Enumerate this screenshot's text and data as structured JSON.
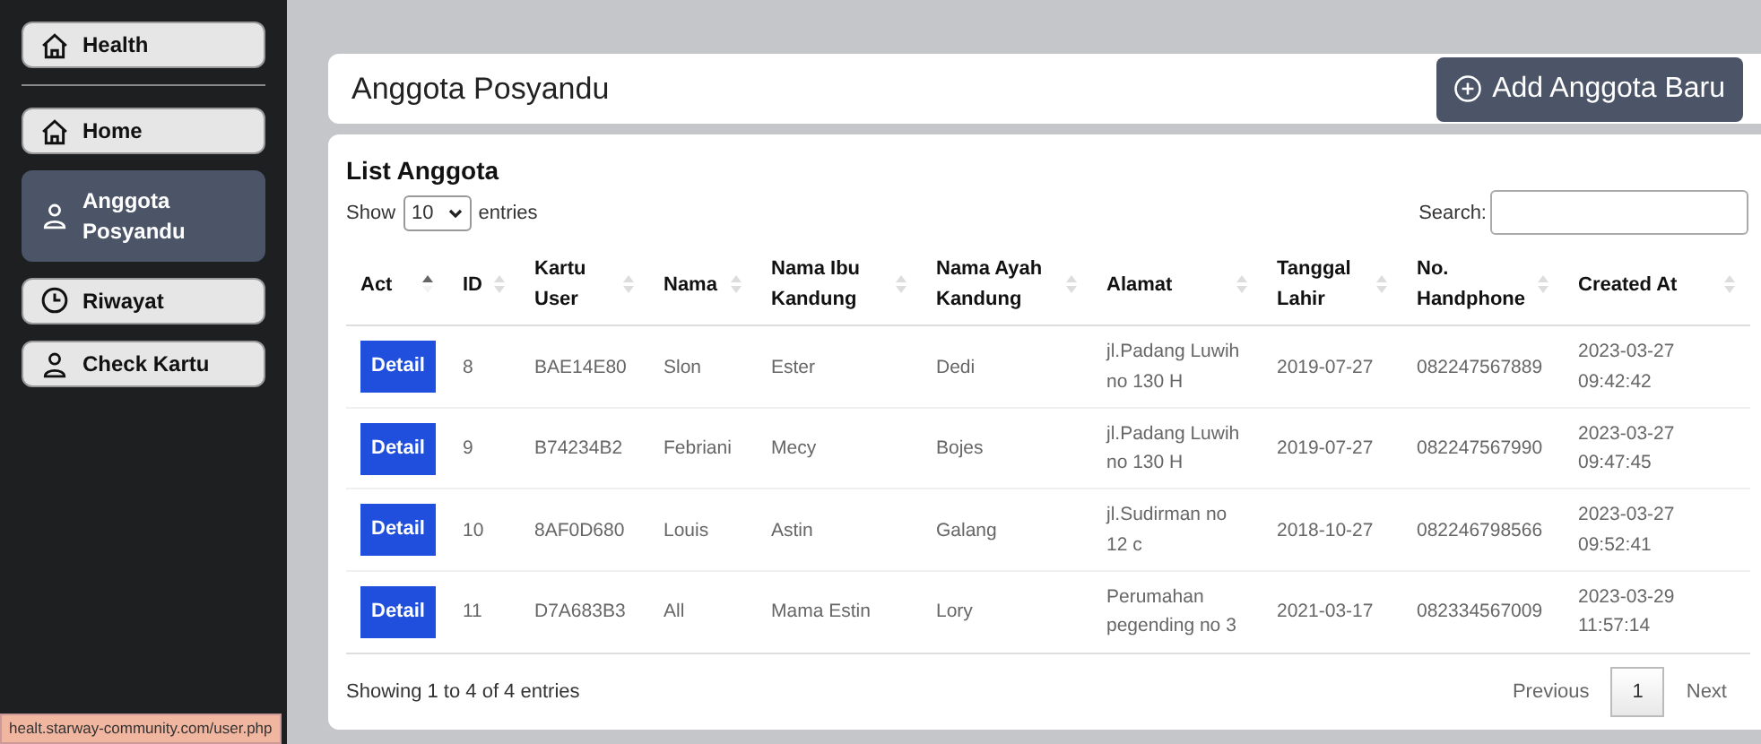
{
  "sidebar": {
    "brand": {
      "label": "Health"
    },
    "items": [
      {
        "label": "Home",
        "selected": false
      },
      {
        "label": "Anggota Posyandu",
        "selected": true
      },
      {
        "label": "Riwayat",
        "selected": false
      },
      {
        "label": "Check Kartu",
        "selected": false
      }
    ]
  },
  "header": {
    "title": "Anggota Posyandu",
    "button": {
      "label": "Add Anggota Baru"
    }
  },
  "list": {
    "title": "List Anggota",
    "length": {
      "before": "Show",
      "value": "10",
      "after": "entries"
    },
    "search_label": "Search:",
    "table": {
      "columns": [
        {
          "label": "Act",
          "sorted": true
        },
        {
          "label": "ID",
          "sorted": false
        },
        {
          "label": "Kartu User",
          "sorted": false
        },
        {
          "label": "Nama",
          "sorted": false
        },
        {
          "label": "Nama Ibu Kandung",
          "sorted": false
        },
        {
          "label": "Nama Ayah Kandung",
          "sorted": false
        },
        {
          "label": "Alamat",
          "sorted": false
        },
        {
          "label": "Tanggal Lahir",
          "sorted": false
        },
        {
          "label": "No. Handphone",
          "sorted": false
        },
        {
          "label": "Created At",
          "sorted": false
        }
      ],
      "rows": [
        {
          "cells": [
            "Detail",
            "8",
            "BAE14E80",
            "Slon",
            "Ester",
            "Dedi",
            "jl.Padang Luwih no 130 H",
            "2019-07-27",
            "082247567889",
            "2023-03-27 09:42:42"
          ]
        },
        {
          "cells": [
            "Detail",
            "9",
            "B74234B2",
            "Febriani",
            "Mecy",
            "Bojes",
            "jl.Padang Luwih no 130 H",
            "2019-07-27",
            "082247567990",
            "2023-03-27 09:47:45"
          ]
        },
        {
          "cells": [
            "Detail",
            "10",
            "8AF0D680",
            "Louis",
            "Astin",
            "Galang",
            "jl.Sudirman no 12 c",
            "2018-10-27",
            "082246798566",
            "2023-03-27 09:52:41"
          ]
        },
        {
          "cells": [
            "Detail",
            "11",
            "D7A683B3",
            "All",
            "Mama Estin",
            "Lory",
            "Perumahan pegending no 3",
            "2021-03-17",
            "082334567009",
            "2023-03-29 11:57:14"
          ]
        }
      ]
    },
    "info": "Showing 1 to 4 of 4 entries",
    "pagination": [
      {
        "label": "Previous",
        "selected": false
      },
      {
        "label": "1",
        "selected": true
      },
      {
        "label": "Next",
        "selected": false
      }
    ]
  },
  "status_bar": "healt.starway-community.com/user.php"
}
